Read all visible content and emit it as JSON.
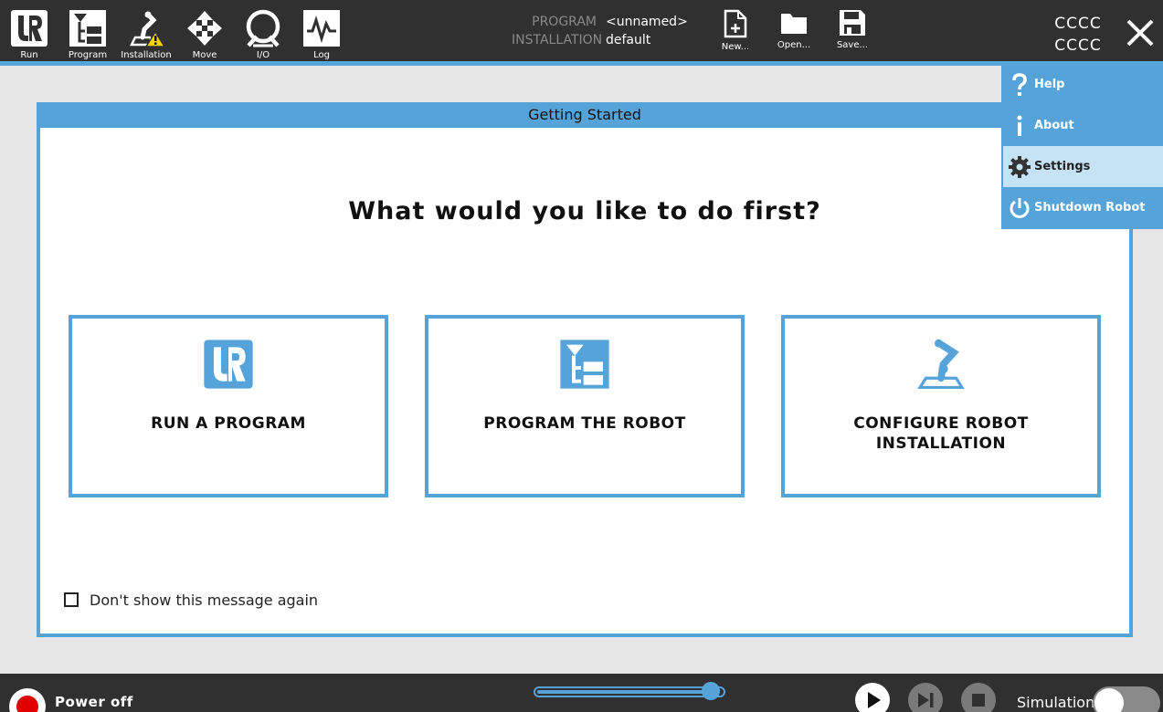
{
  "nav": {
    "run": "Run",
    "program": "Program",
    "installation": "Installation",
    "move": "Move",
    "io": "I/O",
    "log": "Log"
  },
  "program_info": {
    "program_key": "PROGRAM",
    "program_value": "<unnamed>",
    "installation_key": "INSTALLATION",
    "installation_value": "default"
  },
  "file_actions": {
    "new": "New...",
    "open": "Open...",
    "save": "Save..."
  },
  "robot_name": {
    "line1": "CCCC",
    "line2": "CCCC"
  },
  "menu": {
    "items": [
      {
        "label": "Help",
        "icon": "question-icon"
      },
      {
        "label": "About",
        "icon": "info-icon"
      },
      {
        "label": "Settings",
        "icon": "gear-icon",
        "selected": true
      },
      {
        "label": "Shutdown Robot",
        "icon": "power-icon"
      }
    ]
  },
  "dialog": {
    "title": "Getting Started",
    "heading": "What would you like to do first?",
    "cards": [
      {
        "label": "RUN A PROGRAM",
        "icon": "ur-logo-icon"
      },
      {
        "label": "PROGRAM THE ROBOT",
        "icon": "program-tree-icon"
      },
      {
        "label": "CONFIGURE ROBOT INSTALLATION",
        "icon": "robot-arm-icon"
      }
    ],
    "dont_show": "Don't show this message again",
    "dont_show_checked": false
  },
  "bottom": {
    "power_label": "Power off",
    "speed_fraction": 0.98,
    "simulation_label": "Simulation",
    "simulation_on": false
  },
  "colors": {
    "accent": "#56a3d9",
    "bar": "#303030",
    "background": "#e6e6e6",
    "power_indicator": "#e00000",
    "menu_selected": "#c6e2f5"
  }
}
